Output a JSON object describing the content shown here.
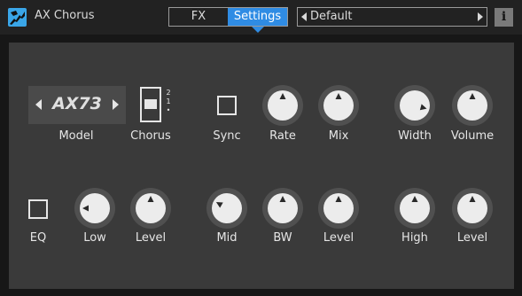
{
  "header": {
    "app_title": "AX Chorus",
    "tabs": [
      {
        "label": "FX",
        "active": false
      },
      {
        "label": "Settings",
        "active": true
      }
    ],
    "preset": {
      "name": "Default"
    },
    "info_label": "i",
    "accent_color": "#2f8ce4"
  },
  "controls": {
    "model": {
      "label": "Model",
      "value": "AX73"
    },
    "chorus": {
      "label": "Chorus",
      "options": [
        "2",
        "1",
        "•"
      ],
      "selected": "1"
    },
    "sync": {
      "label": "Sync",
      "checked": false
    },
    "rate": {
      "label": "Rate",
      "level": 0.5
    },
    "mix": {
      "label": "Mix",
      "level": 0.5
    },
    "width": {
      "label": "Width",
      "level": 0.85
    },
    "volume": {
      "label": "Volume",
      "level": 0.5
    },
    "eq": {
      "label": "EQ",
      "checked": false
    },
    "low": {
      "label": "Low",
      "level": 0.2
    },
    "low_level": {
      "label": "Level",
      "level": 0.5
    },
    "mid": {
      "label": "Mid",
      "level": 0.3
    },
    "bw": {
      "label": "BW",
      "level": 0.5
    },
    "mid_level": {
      "label": "Level",
      "level": 0.5
    },
    "high": {
      "label": "High",
      "level": 0.5
    },
    "high_level": {
      "label": "Level",
      "level": 0.5
    }
  }
}
